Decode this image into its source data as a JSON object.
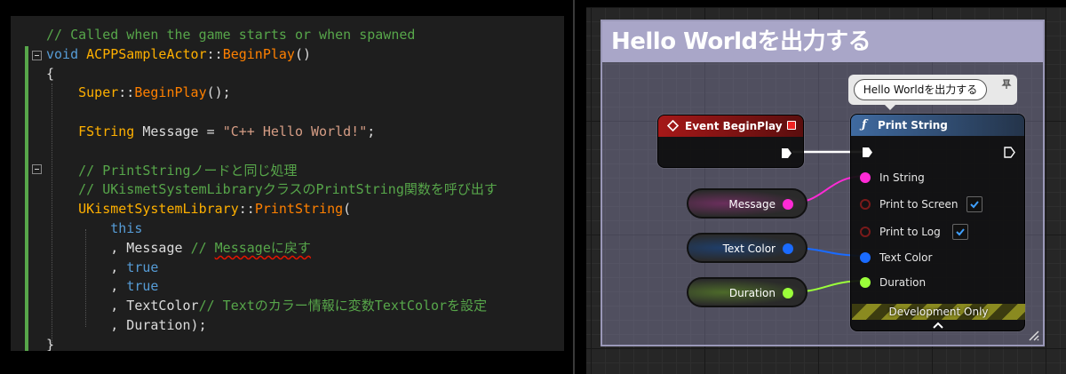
{
  "editor": {
    "lines": [
      {
        "tokens": [
          {
            "t": "// Called when the game starts or when spawned",
            "c": "comment"
          }
        ]
      },
      {
        "tokens": [
          {
            "t": "void",
            "c": "kw"
          },
          {
            "t": " ",
            "c": "plain"
          },
          {
            "t": "ACPPSampleActor",
            "c": "type"
          },
          {
            "t": "::",
            "c": "plain"
          },
          {
            "t": "BeginPlay",
            "c": "fn"
          },
          {
            "t": "()",
            "c": "plain"
          }
        ]
      },
      {
        "tokens": [
          {
            "t": "{",
            "c": "plain"
          }
        ]
      },
      {
        "tokens": [
          {
            "t": "    ",
            "c": "plain"
          },
          {
            "t": "Super",
            "c": "type"
          },
          {
            "t": "::",
            "c": "plain"
          },
          {
            "t": "BeginPlay",
            "c": "fn"
          },
          {
            "t": "();",
            "c": "plain"
          }
        ]
      },
      {
        "tokens": [
          {
            "t": "",
            "c": "plain"
          }
        ]
      },
      {
        "tokens": [
          {
            "t": "    ",
            "c": "plain"
          },
          {
            "t": "FString",
            "c": "type"
          },
          {
            "t": " Message = ",
            "c": "plain"
          },
          {
            "t": "\"C++ Hello World!\"",
            "c": "str"
          },
          {
            "t": ";",
            "c": "plain"
          }
        ]
      },
      {
        "tokens": [
          {
            "t": "",
            "c": "plain"
          }
        ]
      },
      {
        "tokens": [
          {
            "t": "    // PrintStringノードと同じ処理",
            "c": "comment"
          }
        ]
      },
      {
        "tokens": [
          {
            "t": "    // UKismetSystemLibraryクラスのPrintString関数を呼び出す",
            "c": "comment"
          }
        ]
      },
      {
        "tokens": [
          {
            "t": "    ",
            "c": "plain"
          },
          {
            "t": "UKismetSystemLibrary",
            "c": "type"
          },
          {
            "t": "::",
            "c": "plain"
          },
          {
            "t": "PrintString",
            "c": "fn"
          },
          {
            "t": "(",
            "c": "plain"
          }
        ]
      },
      {
        "tokens": [
          {
            "t": "        ",
            "c": "plain"
          },
          {
            "t": "this",
            "c": "kw"
          }
        ]
      },
      {
        "tokens": [
          {
            "t": "        , Message ",
            "c": "plain"
          },
          {
            "t": "// ",
            "c": "comment"
          },
          {
            "t": "Messageに戻す",
            "c": "comment",
            "squiggle": true
          }
        ]
      },
      {
        "tokens": [
          {
            "t": "        , ",
            "c": "plain"
          },
          {
            "t": "true",
            "c": "kw"
          }
        ]
      },
      {
        "tokens": [
          {
            "t": "        , ",
            "c": "plain"
          },
          {
            "t": "true",
            "c": "kw"
          }
        ]
      },
      {
        "tokens": [
          {
            "t": "        , TextColor",
            "c": "plain"
          },
          {
            "t": "// Textのカラー情報に変数TextColorを設定",
            "c": "comment"
          }
        ]
      },
      {
        "tokens": [
          {
            "t": "        , Duration);",
            "c": "plain"
          }
        ]
      },
      {
        "tokens": [
          {
            "t": "}",
            "c": "plain"
          }
        ]
      }
    ]
  },
  "blueprint": {
    "comment_title": "Hello Worldを出力する",
    "bubble_text": "Hello Worldを出力する",
    "event_node": {
      "title": "Event BeginPlay",
      "color": "#a51818"
    },
    "print_node": {
      "title": "Print String",
      "color": "#3f6aa0",
      "pins": [
        {
          "label": "In String",
          "color": "#ff2ad6",
          "connected": true
        },
        {
          "label": "Print to Screen",
          "checked": true
        },
        {
          "label": "Print to Log",
          "checked": true
        },
        {
          "label": "Text Color",
          "color": "#1a6bff",
          "connected": true
        },
        {
          "label": "Duration",
          "color": "#9bff3a",
          "connected": true
        }
      ],
      "footer_label": "Development Only"
    },
    "variables": [
      {
        "name": "Message",
        "color": "#ff2ad6"
      },
      {
        "name": "Text Color",
        "color": "#1a6bff"
      },
      {
        "name": "Duration",
        "color": "#9bff3a"
      }
    ]
  }
}
